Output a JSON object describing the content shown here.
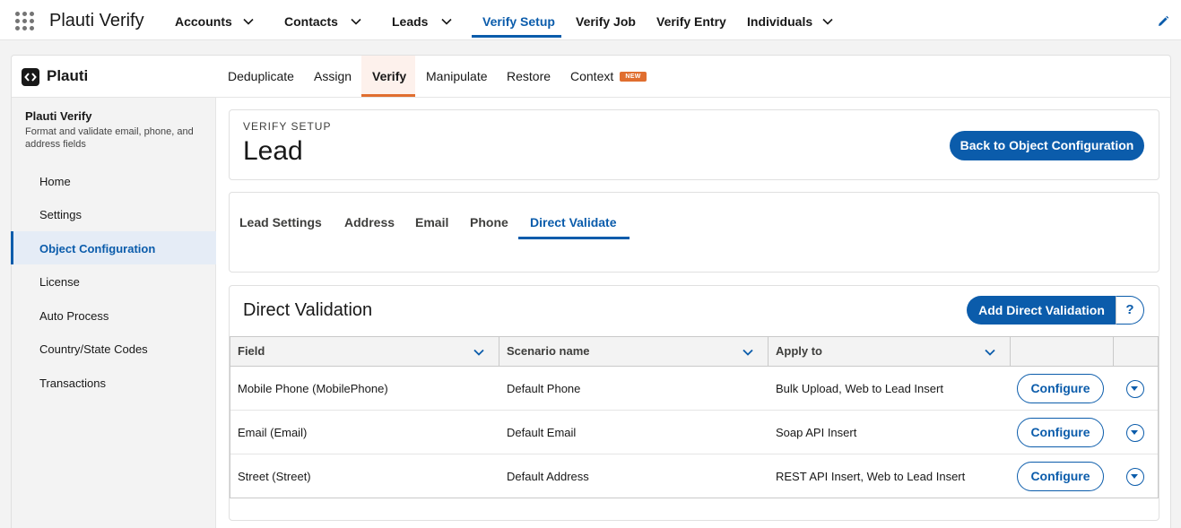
{
  "global_nav": {
    "app_name": "Plauti Verify",
    "items": [
      {
        "label": "Accounts",
        "has_menu": true
      },
      {
        "label": "Contacts",
        "has_menu": true
      },
      {
        "label": "Leads",
        "has_menu": true
      },
      {
        "label": "Verify Setup",
        "has_menu": false,
        "active": true
      },
      {
        "label": "Verify Job",
        "has_menu": false
      },
      {
        "label": "Verify Entry",
        "has_menu": false
      },
      {
        "label": "Individuals",
        "has_menu": true
      }
    ],
    "icons": {
      "launcher": "app-launcher-icon",
      "edit": "pencil-icon"
    }
  },
  "brand": {
    "name": "Plauti"
  },
  "sub_nav": {
    "items": [
      {
        "label": "Deduplicate"
      },
      {
        "label": "Assign"
      },
      {
        "label": "Verify",
        "active": true
      },
      {
        "label": "Manipulate"
      },
      {
        "label": "Restore"
      },
      {
        "label": "Context",
        "badge": "NEW"
      }
    ]
  },
  "sidebar": {
    "title": "Plauti Verify",
    "description": "Format and validate email, phone, and address fields",
    "items": [
      {
        "label": "Home"
      },
      {
        "label": "Settings"
      },
      {
        "label": "Object Configuration",
        "active": true
      },
      {
        "label": "License"
      },
      {
        "label": "Auto Process"
      },
      {
        "label": "Country/State Codes"
      },
      {
        "label": "Transactions"
      }
    ]
  },
  "header": {
    "eyebrow": "VERIFY SETUP",
    "title": "Lead",
    "back_button": "Back to Object Configuration"
  },
  "tabs": [
    {
      "label": "Lead Settings"
    },
    {
      "label": "Address"
    },
    {
      "label": "Email"
    },
    {
      "label": "Phone"
    },
    {
      "label": "Direct Validate",
      "active": true
    }
  ],
  "direct_validation": {
    "title": "Direct Validation",
    "add_button": "Add Direct Validation",
    "help": "?",
    "columns": [
      "Field",
      "Scenario name",
      "Apply to"
    ],
    "rows": [
      {
        "field": "Mobile Phone (MobilePhone)",
        "scenario": "Default Phone",
        "apply_to": "Bulk Upload, Web to Lead Insert",
        "action": "Configure"
      },
      {
        "field": "Email (Email)",
        "scenario": "Default Email",
        "apply_to": "Soap API Insert",
        "action": "Configure"
      },
      {
        "field": "Street (Street)",
        "scenario": "Default Address",
        "apply_to": "REST API Insert, Web to Lead Insert",
        "action": "Configure"
      }
    ]
  },
  "colors": {
    "accent": "#0b5cab",
    "brand_orange": "#e06e2f",
    "background": "#f3f3f3"
  }
}
